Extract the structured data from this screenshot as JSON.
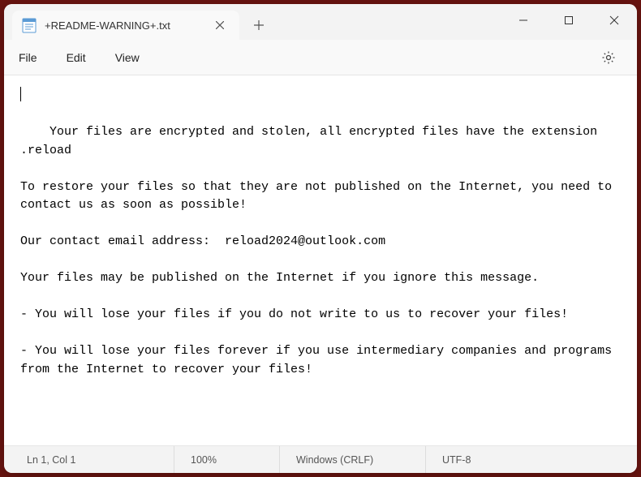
{
  "titlebar": {
    "tab_title": "+README-WARNING+.txt"
  },
  "menubar": {
    "file": "File",
    "edit": "Edit",
    "view": "View"
  },
  "content": {
    "text": "Your files are encrypted and stolen, all encrypted files have the extension .reload\n\nTo restore your files so that they are not published on the Internet, you need to contact us as soon as possible!\n\nOur contact email address:  reload2024@outlook.com\n\nYour files may be published on the Internet if you ignore this message.\n\n- You will lose your files if you do not write to us to recover your files!\n\n- You will lose your files forever if you use intermediary companies and programs from the Internet to recover your files!"
  },
  "statusbar": {
    "position": "Ln 1, Col 1",
    "zoom": "100%",
    "line_ending": "Windows (CRLF)",
    "encoding": "UTF-8"
  }
}
